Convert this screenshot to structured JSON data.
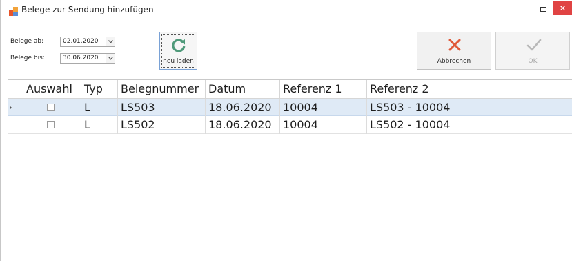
{
  "window": {
    "title": "Belege zur Sendung hinzufügen",
    "minimize": "–",
    "close": "✕"
  },
  "filters": {
    "from_label": "Belege ab:",
    "from_value": "02.01.2020",
    "to_label": "Belege bis:",
    "to_value": "30.06.2020"
  },
  "toolbar": {
    "reload_label": "neu laden",
    "cancel_label": "Abbrechen",
    "ok_label": "OK"
  },
  "grid": {
    "columns": [
      "Auswahl",
      "Typ",
      "Belegnummer",
      "Datum",
      "Referenz 1",
      "Referenz 2"
    ],
    "rows": [
      {
        "selected": true,
        "auswahl": false,
        "typ": "L",
        "belegnummer": "LS503",
        "datum": "18.06.2020",
        "referenz1": "10004",
        "referenz2": "LS503 - 10004"
      },
      {
        "selected": false,
        "auswahl": false,
        "typ": "L",
        "belegnummer": "LS502",
        "datum": "18.06.2020",
        "referenz1": "10004",
        "referenz2": "LS502 - 10004"
      }
    ]
  },
  "colors": {
    "selection": "#dfeaf6",
    "cancel_x": "#e05a3a",
    "reload_icon": "#4f9a7a",
    "close_button": "#e04343"
  }
}
